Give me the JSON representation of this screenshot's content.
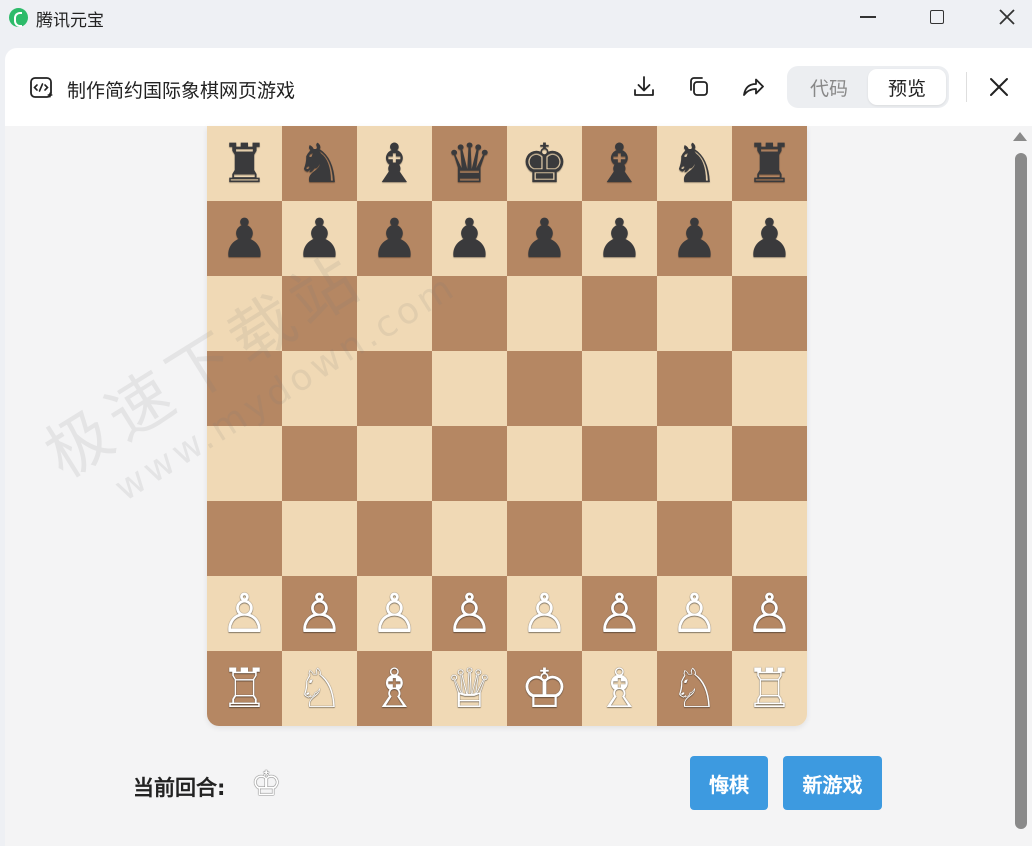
{
  "window": {
    "app_title": "腾讯元宝",
    "controls": [
      "minimize",
      "maximize",
      "close"
    ]
  },
  "header": {
    "title": "制作简约国际象棋网页游戏",
    "icons": [
      "code-icon",
      "download-icon",
      "copy-icon",
      "share-icon",
      "close-icon"
    ],
    "tabs": [
      {
        "label": "代码",
        "active": false
      },
      {
        "label": "预览",
        "active": true
      }
    ]
  },
  "board": {
    "light_color": "#f0d9b5",
    "dark_color": "#b58763",
    "rows": [
      [
        "♜",
        "♞",
        "♝",
        "♛",
        "♚",
        "♝",
        "♞",
        "♜"
      ],
      [
        "♟",
        "♟",
        "♟",
        "♟",
        "♟",
        "♟",
        "♟",
        "♟"
      ],
      [
        "",
        "",
        "",
        "",
        "",
        "",
        "",
        ""
      ],
      [
        "",
        "",
        "",
        "",
        "",
        "",
        "",
        ""
      ],
      [
        "",
        "",
        "",
        "",
        "",
        "",
        "",
        ""
      ],
      [
        "",
        "",
        "",
        "",
        "",
        "",
        "",
        ""
      ],
      [
        "♙",
        "♙",
        "♙",
        "♙",
        "♙",
        "♙",
        "♙",
        "♙"
      ],
      [
        "♖",
        "♘",
        "♗",
        "♕",
        "♔",
        "♗",
        "♘",
        "♖"
      ]
    ]
  },
  "status": {
    "turn_label": "当前回合:",
    "turn_piece": "♔"
  },
  "buttons": {
    "undo": "悔棋",
    "new_game": "新游戏",
    "color": "#3d9ae0"
  },
  "watermark": {
    "line1": "极速下载站",
    "line2": "www.mydown.com"
  }
}
